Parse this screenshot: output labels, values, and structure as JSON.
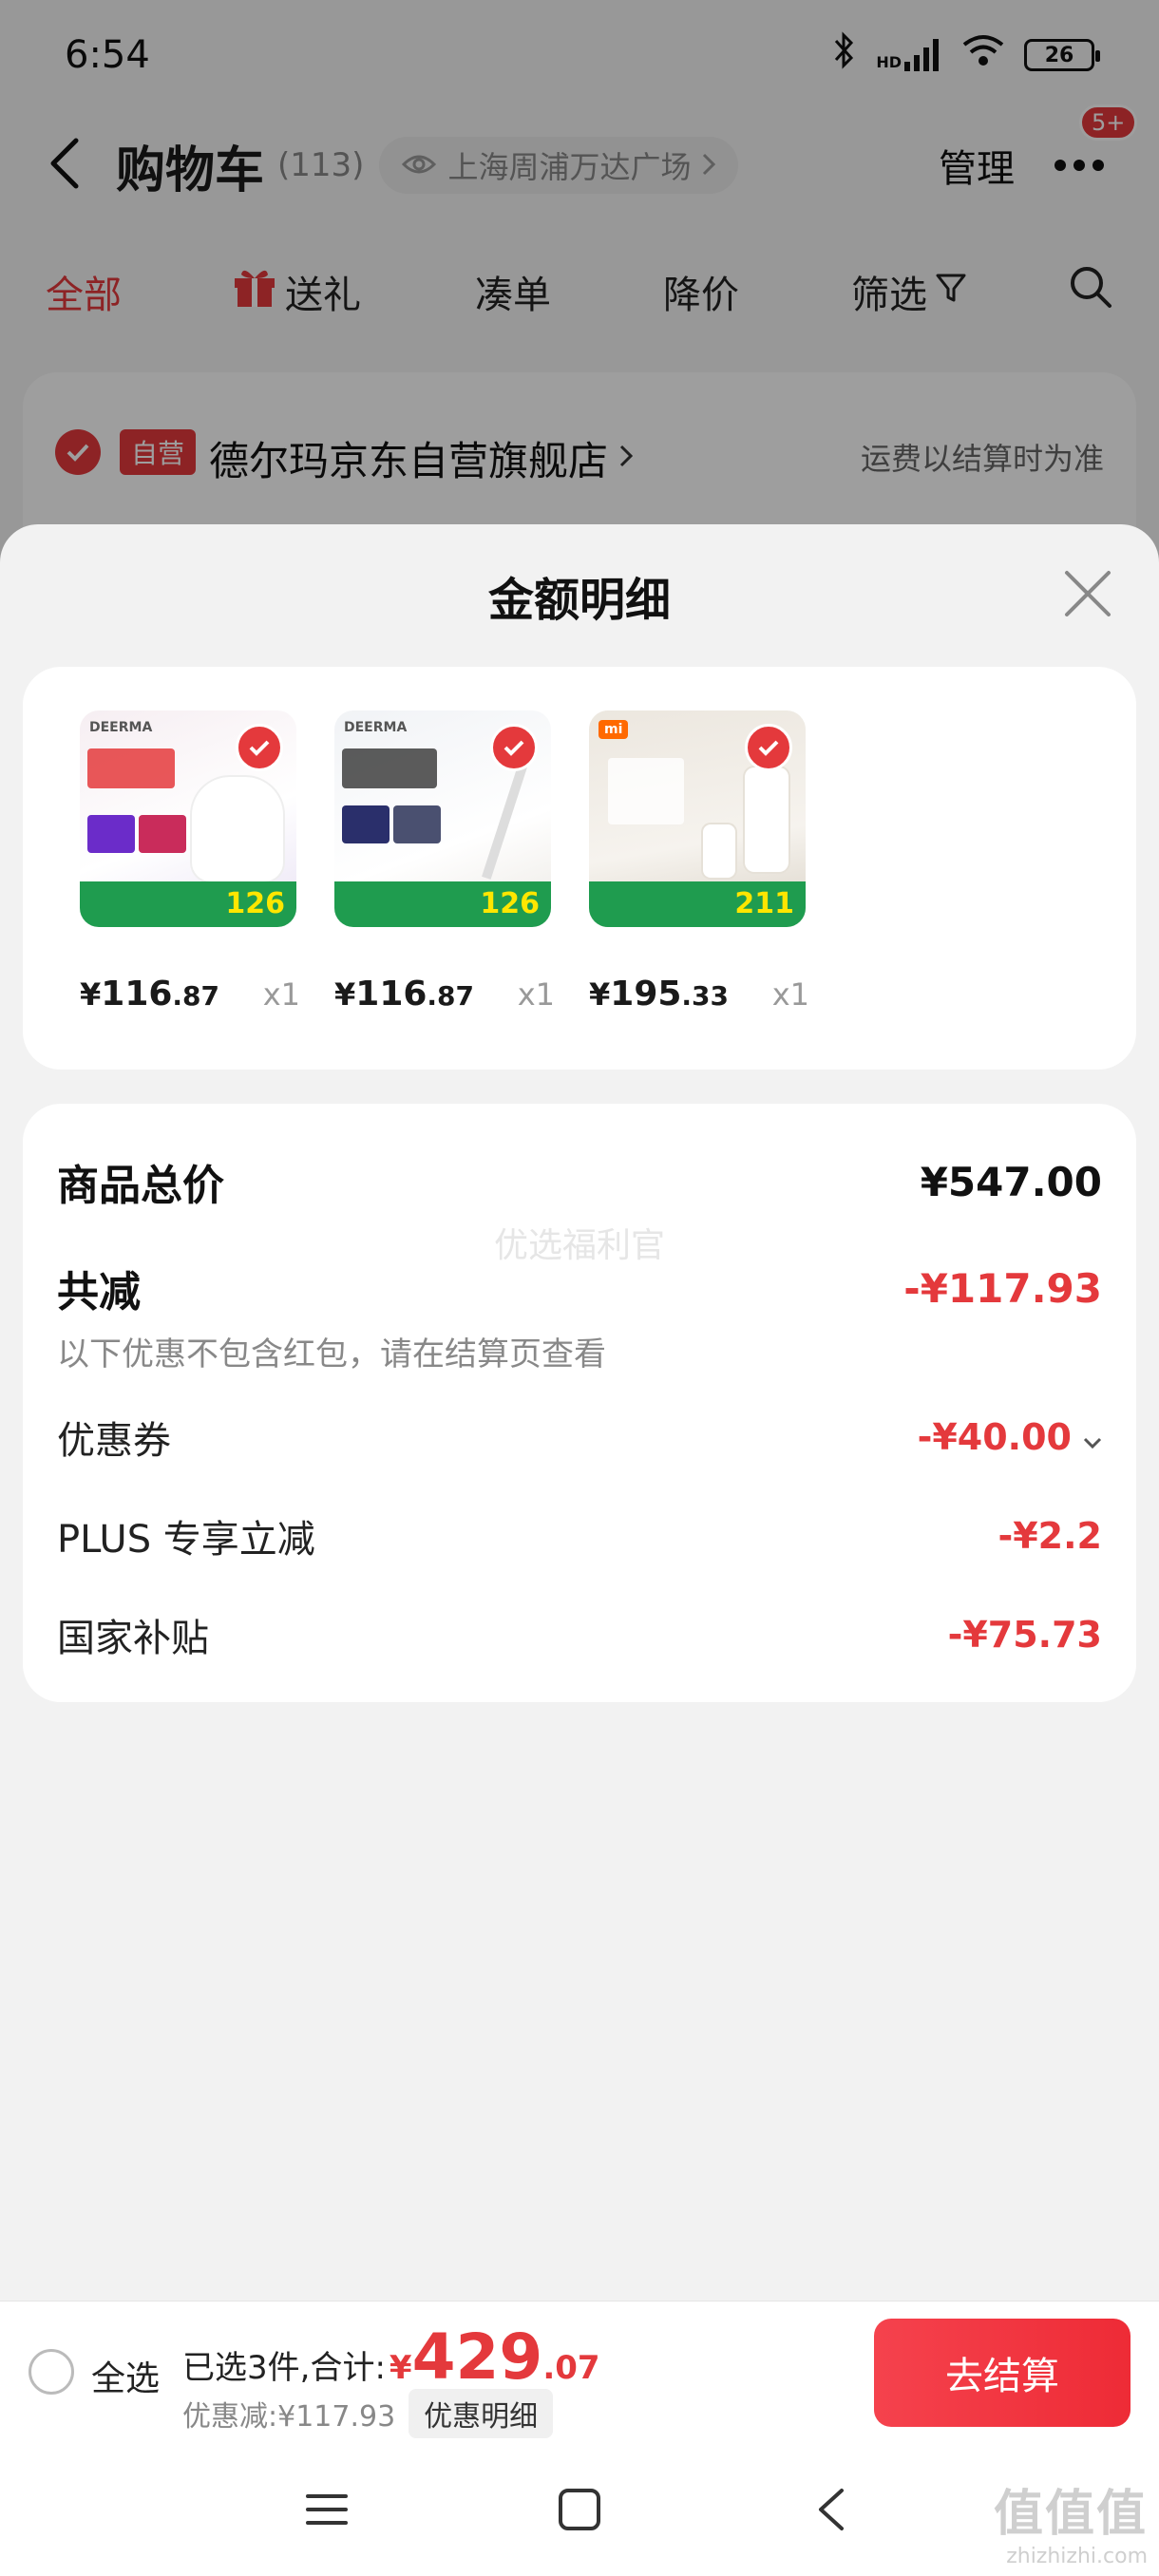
{
  "status_bar": {
    "time": "6:54",
    "network": "HD",
    "battery": "26"
  },
  "nav": {
    "title": "购物车",
    "count": "(113)",
    "location": "上海周浦万达广场",
    "manage_label": "管理",
    "more_badge": "5+"
  },
  "tabs": [
    {
      "label": "全部",
      "active": true
    },
    {
      "label": "送礼"
    },
    {
      "label": "凑单"
    },
    {
      "label": "降价"
    },
    {
      "label": "筛选"
    }
  ],
  "shop": {
    "tag": "自营",
    "name": "德尔玛京东自营旗舰店",
    "shipping_note": "运费以结算时为准"
  },
  "sheet": {
    "title": "金额明细",
    "items": [
      {
        "brand": "DEERMA",
        "banner_price": "126",
        "price_symbol": "¥",
        "price_int": "116",
        "price_dec": ".87",
        "qty": "x1"
      },
      {
        "brand": "DEERMA",
        "banner_price": "126",
        "price_symbol": "¥",
        "price_int": "116",
        "price_dec": ".87",
        "qty": "x1"
      },
      {
        "brand": "mi",
        "banner_price": "211",
        "price_symbol": "¥",
        "price_int": "195",
        "price_dec": ".33",
        "qty": "x1"
      }
    ],
    "summary": {
      "total_label": "商品总价",
      "total_value": "¥547.00",
      "watermark": "优选福利官",
      "reduce_label": "共减",
      "reduce_value": "-¥117.93",
      "reduce_note": "以下优惠不包含红包，请在结算页查看",
      "coupon_label": "优惠券",
      "coupon_value": "-¥40.00",
      "plus_label": "PLUS 专享立减",
      "plus_value": "-¥2.2",
      "subsidy_label": "国家补贴",
      "subsidy_value": "-¥75.73"
    }
  },
  "bottom": {
    "select_all": "全选",
    "selected_text": "已选3件,合计:",
    "total_symbol": "¥",
    "total_int": "429",
    "total_dec": ".07",
    "discount_text": "优惠减:¥117.93",
    "detail_label": "优惠明细",
    "checkout_label": "去结算"
  },
  "site_watermark": {
    "logo": "值值值",
    "url": "zhizhizhi.com"
  },
  "colors": {
    "accent": "#e4393c",
    "subsidy_green": "#1f9c4f"
  }
}
